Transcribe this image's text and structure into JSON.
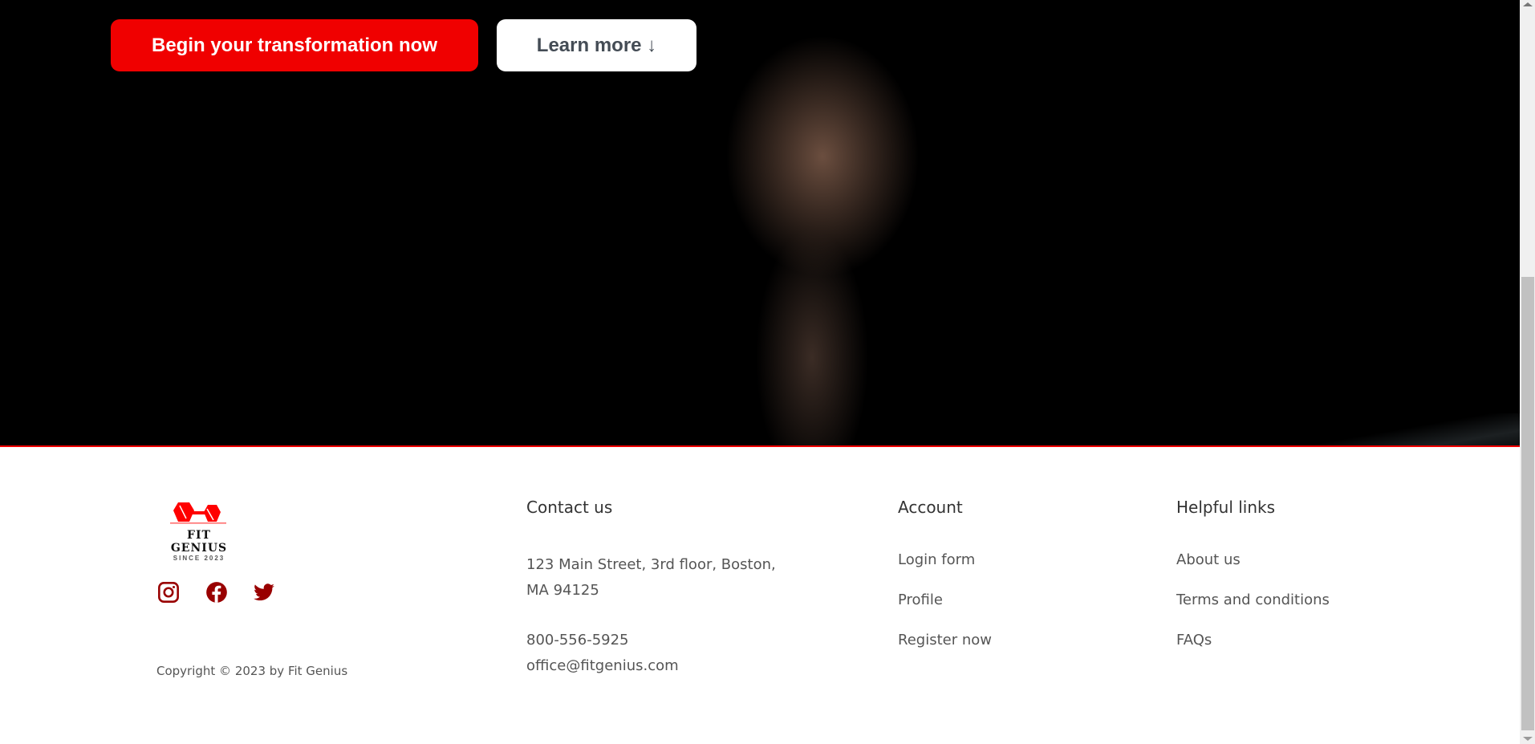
{
  "hero": {
    "primary_button": "Begin your transformation now",
    "secondary_button": "Learn more ↓"
  },
  "brand": {
    "name": "FIT GENIUS",
    "tagline": "SINCE 2023"
  },
  "social": [
    "instagram",
    "facebook",
    "twitter"
  ],
  "copyright": "Copyright © 2023 by Fit Genius",
  "contact": {
    "title": "Contact us",
    "address_line1": "123 Main Street, 3rd floor, Boston,",
    "address_line2": "MA 94125",
    "phone": "800-556-5925",
    "email": "office@fitgenius.com"
  },
  "account": {
    "title": "Account",
    "links": [
      "Login form",
      "Profile",
      "Register now"
    ]
  },
  "helpful": {
    "title": "Helpful links",
    "links": [
      "About us",
      "Terms and conditions",
      "FAQs"
    ]
  },
  "colors": {
    "accent": "#f00000",
    "social": "#990000"
  }
}
